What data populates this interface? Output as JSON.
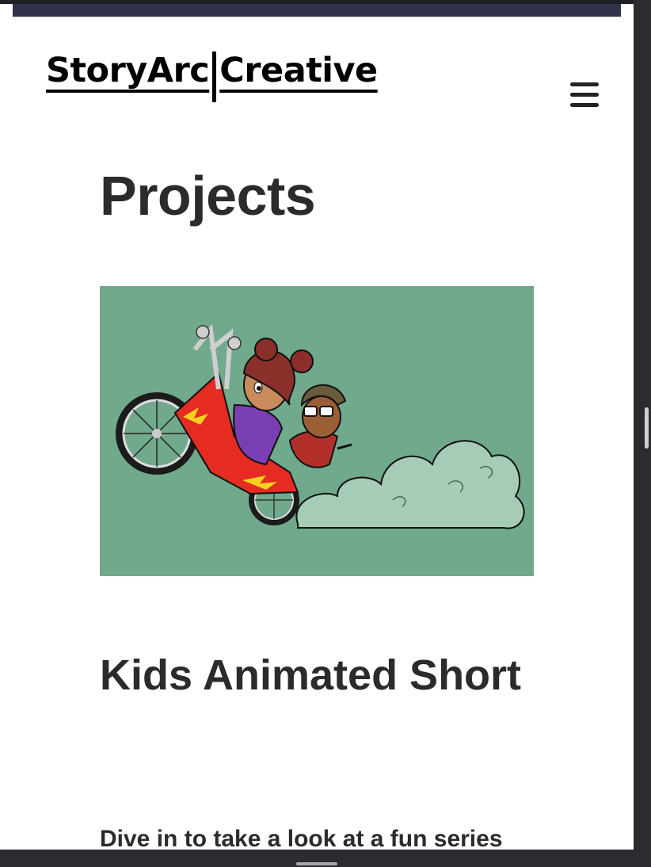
{
  "header": {
    "logo": {
      "part1": "StoryArc",
      "part2": "Creative"
    },
    "menu_icon": "hamburger-menu-icon"
  },
  "main": {
    "title": "Projects",
    "hero_image": {
      "alt": "Cartoon of two kids riding a red flame-decorated chopper bike leaving a dust cloud",
      "background": "#70a98c"
    },
    "project": {
      "title": "Kids Animated Short",
      "description": "Dive in to take a look at a fun series"
    }
  },
  "colors": {
    "text": "#2b2b2b",
    "hero_bg": "#70a98c",
    "chrome": "#2b2c30"
  }
}
